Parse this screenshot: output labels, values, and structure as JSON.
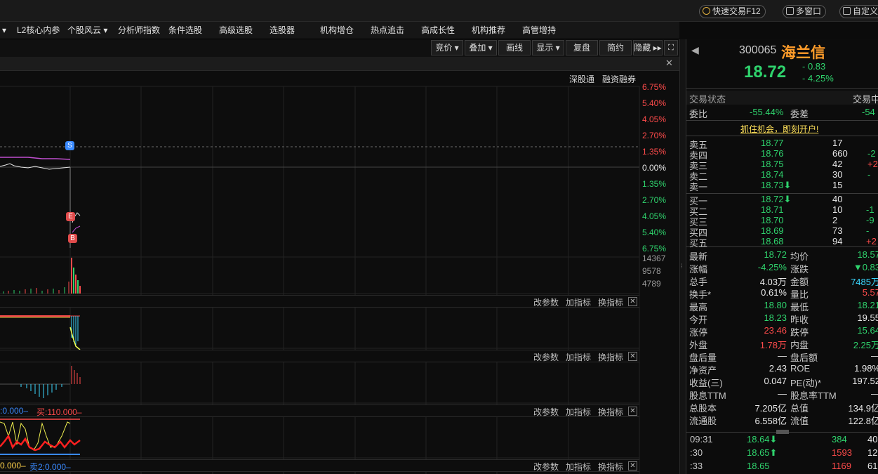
{
  "titlebar": {
    "quick_trade": "快速交易F12",
    "multi_window": "多窗口",
    "custom": "自定义"
  },
  "menubar": {
    "items": [
      "▾",
      "L2核心内参",
      "个股风云 ▾",
      "分析师指数",
      "条件选股",
      "高级选股",
      "选股器",
      "机构增仓",
      "热点追击",
      "高成长性",
      "机构推荐",
      "高管增持"
    ]
  },
  "toolbar": {
    "items": [
      "竞价 ▾",
      "叠加 ▾",
      "画线",
      "显示 ▾",
      "复盘",
      "简约",
      "隐藏 ▸▸"
    ]
  },
  "subhead": {
    "links": [
      "深股通",
      "融资融券"
    ],
    "close": "✕"
  },
  "price_axis": [
    {
      "v": "6.75%",
      "c": "red"
    },
    {
      "v": "5.40%",
      "c": "red"
    },
    {
      "v": "4.05%",
      "c": "red"
    },
    {
      "v": "2.70%",
      "c": "red"
    },
    {
      "v": "1.35%",
      "c": "red"
    },
    {
      "v": "0.00%",
      "c": "white"
    },
    {
      "v": "1.35%",
      "c": "green"
    },
    {
      "v": "2.70%",
      "c": "green"
    },
    {
      "v": "4.05%",
      "c": "green"
    },
    {
      "v": "5.40%",
      "c": "green"
    },
    {
      "v": "6.75%",
      "c": "green"
    }
  ],
  "volume_axis": [
    "14367",
    "9578",
    "4789"
  ],
  "markers": {
    "s": "S",
    "e": "E",
    "b": "B"
  },
  "panel_bar": {
    "modify": "改参数",
    "add": "加指标",
    "switch": "换指标",
    "close": "✕"
  },
  "indicator": {
    "buy_label": ":0.000–",
    "sell1_label": "买:110.000–",
    "low_left": "0.000–",
    "sell2_label": "卖2:0.000–"
  },
  "stock": {
    "code": "300065",
    "name": "海兰信",
    "price": "18.72",
    "change": "- 0.83",
    "change_pct": "- 4.25%"
  },
  "status": {
    "label": "交易状态",
    "value": "交易中",
    "ratio_label": "委比",
    "ratio": "-55.44%",
    "diff_label": "委差",
    "diff": "-54"
  },
  "promo": "抓住机会，即刻开户!",
  "asks": [
    {
      "label": "卖五",
      "price": "18.77",
      "vol": "17",
      "chg": ""
    },
    {
      "label": "卖四",
      "price": "18.76",
      "vol": "660",
      "chg": "-2"
    },
    {
      "label": "卖三",
      "price": "18.75",
      "vol": "42",
      "chg": "+2"
    },
    {
      "label": "卖二",
      "price": "18.74",
      "vol": "30",
      "chg": "-"
    },
    {
      "label": "卖一",
      "price": "18.73⬇",
      "vol": "15",
      "chg": ""
    }
  ],
  "bids": [
    {
      "label": "买一",
      "price": "18.72⬇",
      "vol": "40",
      "chg": ""
    },
    {
      "label": "买二",
      "price": "18.71",
      "vol": "10",
      "chg": "-1"
    },
    {
      "label": "买三",
      "price": "18.70",
      "vol": "2",
      "chg": "-9"
    },
    {
      "label": "买四",
      "price": "18.69",
      "vol": "73",
      "chg": "-"
    },
    {
      "label": "买五",
      "price": "18.68",
      "vol": "94",
      "chg": "+2"
    }
  ],
  "stats": [
    {
      "l1": "最新",
      "v1": "18.72",
      "c1": "green",
      "l2": "均价",
      "v2": "18.57",
      "c2": "green"
    },
    {
      "l1": "涨幅",
      "v1": "-4.25%",
      "c1": "green",
      "l2": "涨跌",
      "v2": "▼0.83",
      "c2": "green"
    },
    {
      "l1": "总手",
      "v1": "4.03万",
      "c1": "white",
      "l2": "金额",
      "v2": "7485万",
      "c2": "cyan"
    },
    {
      "l1": "换手*",
      "v1": "0.61%",
      "c1": "white",
      "l2": "量比",
      "v2": "5.57",
      "c2": "red"
    },
    {
      "l1": "最高",
      "v1": "18.80",
      "c1": "green",
      "l2": "最低",
      "v2": "18.21",
      "c2": "green"
    },
    {
      "l1": "今开",
      "v1": "18.23",
      "c1": "green",
      "l2": "昨收",
      "v2": "19.55",
      "c2": "white"
    },
    {
      "l1": "涨停",
      "v1": "23.46",
      "c1": "red",
      "l2": "跌停",
      "v2": "15.64",
      "c2": "green"
    },
    {
      "l1": "外盘",
      "v1": "1.78万",
      "c1": "red",
      "l2": "内盘",
      "v2": "2.25万",
      "c2": "green"
    },
    {
      "l1": "盘后量",
      "v1": "—",
      "c1": "white",
      "l2": "盘后额",
      "v2": "—",
      "c2": "white"
    },
    {
      "l1": "净资产",
      "v1": "2.43",
      "c1": "white",
      "l2": "ROE",
      "v2": "1.98%",
      "c2": "white"
    },
    {
      "l1": "收益(三)",
      "v1": "0.047",
      "c1": "white",
      "l2": "PE(动)*",
      "v2": "197.52",
      "c2": "white"
    },
    {
      "l1": "股息TTM",
      "v1": "—",
      "c1": "white",
      "l2": "股息率TTM",
      "v2": "—",
      "c2": "white"
    },
    {
      "l1": "总股本",
      "v1": "7.205亿",
      "c1": "white",
      "l2": "总值",
      "v2": "134.9亿",
      "c2": "white"
    },
    {
      "l1": "流通股",
      "v1": "6.558亿",
      "c1": "white",
      "l2": "流值",
      "v2": "122.8亿",
      "c2": "white"
    }
  ],
  "ticks": [
    {
      "time": "09:31",
      "price": "18.64⬇",
      "pc": "green",
      "vol": "384",
      "vc": "green",
      "n": "40"
    },
    {
      "time": ":30",
      "price": "18.65⬆",
      "pc": "green",
      "vol": "1593",
      "vc": "red",
      "n": "126"
    },
    {
      "time": ":33",
      "price": "18.65",
      "pc": "green",
      "vol": "1169",
      "vc": "red",
      "n": "61"
    }
  ],
  "colors": {
    "up": "#ff4b4b",
    "down": "#2fd36d",
    "stock_name": "#ff9c2a",
    "cyan": "#3ad7ff"
  }
}
